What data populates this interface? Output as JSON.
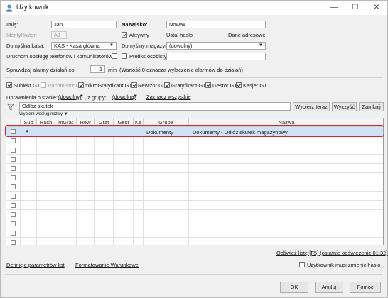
{
  "window": {
    "title": "Użytkownik",
    "minimize": "—",
    "maximize": "☐",
    "close": "✕"
  },
  "form": {
    "first_name_label": "Imię:",
    "first_name_value": "Jan",
    "last_name_label": "Nazwisko:",
    "last_name_value": "Nowak",
    "identifier_label": "Identyfikator:",
    "identifier_value": "AJ",
    "active_label": "Aktywny",
    "password_link": "Ustal hasło",
    "address_link": "Dane adresowe",
    "default_register_label": "Domyślna kasa:",
    "default_register_value": "KAS - Kasa główna",
    "default_warehouse_label": "Domyślny magazyn:",
    "default_warehouse_value": "(dowolny)",
    "phone_service_label": "Uruchom obsługę telefonów i komunikatorów",
    "personal_prefix_label": "Prefiks osobisty:",
    "alarm_label": "Sprawdzaj alarmy działań co:",
    "alarm_value": "1",
    "alarm_unit": "min",
    "alarm_note": "(Wartość 0 oznacza wyłączenie alarmów do działań)"
  },
  "roles": [
    {
      "label": "Subiekt GT",
      "checked": true,
      "disabled": false
    },
    {
      "label": "Rachmistrz GT",
      "checked": false,
      "disabled": true
    },
    {
      "label": "mikroGratyfikant GT",
      "checked": true,
      "disabled": false
    },
    {
      "label": "Rewizor GT",
      "checked": true,
      "disabled": false
    },
    {
      "label": "Gratyfikant GT",
      "checked": true,
      "disabled": false
    },
    {
      "label": "Gestor GT",
      "checked": true,
      "disabled": false
    },
    {
      "label": "Kasjer GT",
      "checked": true,
      "disabled": false
    }
  ],
  "permissions": {
    "status_label": "Uprawnienia o stanie:",
    "status_value": "(dowolny)",
    "group_label": ", z grupy:",
    "group_value": "(dowolna)",
    "select_all_link": "Zaznacz wszystkie",
    "search_value": "Odłóż skutek",
    "choose_now_button": "Wybierz teraz",
    "clear_button": "Wyczyść",
    "close_button": "Zamknij",
    "choose_by_name": "Wybierz według nazwy"
  },
  "grid": {
    "columns": [
      "",
      "Sub",
      "Rach",
      "mGrat",
      "Rew",
      "Grat",
      "Gest",
      "Ka",
      "Grupa",
      "Nazwa"
    ],
    "rows": [
      {
        "selected": true,
        "sub_mark": "●",
        "group": "Dokumenty",
        "name": "Dokumenty - Odłóż skutek magazynowy"
      }
    ]
  },
  "footer": {
    "refresh_link": "Odśwież listę [F5] (ostatnie odświeżenie 01:32)",
    "param_def_link": "Definicje parametrów list",
    "cond_format_link": "Formatowanie Warunkowe",
    "must_change_label": "Użytkownik musi zmienić hasło",
    "ok_button": "OK",
    "cancel_button": "Anuluj",
    "help_button": "Pomoc"
  }
}
